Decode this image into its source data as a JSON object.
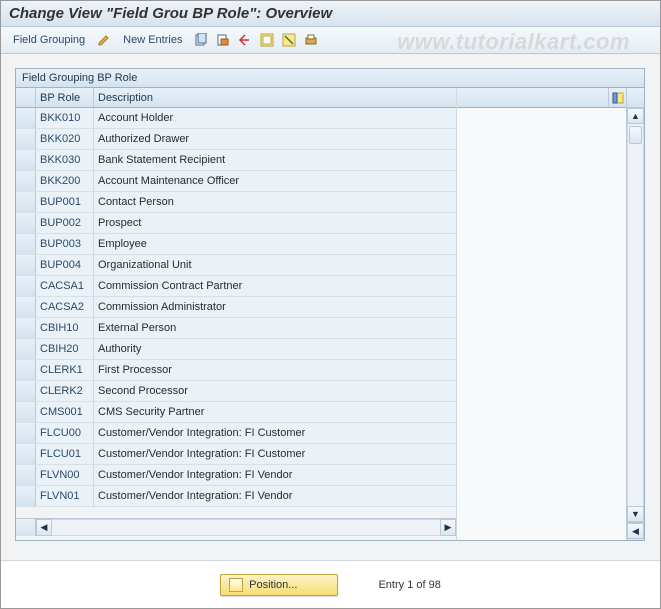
{
  "title": "Change View \"Field Grou BP Role\": Overview",
  "watermark": "www.tutorialkart.com",
  "toolbar": {
    "field_grouping": "Field Grouping",
    "new_entries": "New Entries"
  },
  "panel": {
    "title": "Field Grouping BP Role",
    "col_role": "BP Role",
    "col_desc": "Description"
  },
  "rows": [
    {
      "role": "BKK010",
      "desc": "Account Holder"
    },
    {
      "role": "BKK020",
      "desc": "Authorized Drawer"
    },
    {
      "role": "BKK030",
      "desc": "Bank Statement Recipient"
    },
    {
      "role": "BKK200",
      "desc": "Account Maintenance Officer"
    },
    {
      "role": "BUP001",
      "desc": "Contact Person"
    },
    {
      "role": "BUP002",
      "desc": "Prospect"
    },
    {
      "role": "BUP003",
      "desc": "Employee"
    },
    {
      "role": "BUP004",
      "desc": "Organizational Unit"
    },
    {
      "role": "CACSA1",
      "desc": "Commission Contract Partner"
    },
    {
      "role": "CACSA2",
      "desc": "Commission Administrator"
    },
    {
      "role": "CBIH10",
      "desc": "External Person"
    },
    {
      "role": "CBIH20",
      "desc": "Authority"
    },
    {
      "role": "CLERK1",
      "desc": "First Processor"
    },
    {
      "role": "CLERK2",
      "desc": "Second Processor"
    },
    {
      "role": "CMS001",
      "desc": "CMS Security Partner"
    },
    {
      "role": "FLCU00",
      "desc": "Customer/Vendor Integration: FI Customer"
    },
    {
      "role": "FLCU01",
      "desc": "Customer/Vendor Integration: FI Customer"
    },
    {
      "role": "FLVN00",
      "desc": "Customer/Vendor Integration: FI Vendor"
    },
    {
      "role": "FLVN01",
      "desc": "Customer/Vendor Integration: FI Vendor"
    }
  ],
  "footer": {
    "position_label": "Position...",
    "entry_text": "Entry 1 of 98"
  }
}
